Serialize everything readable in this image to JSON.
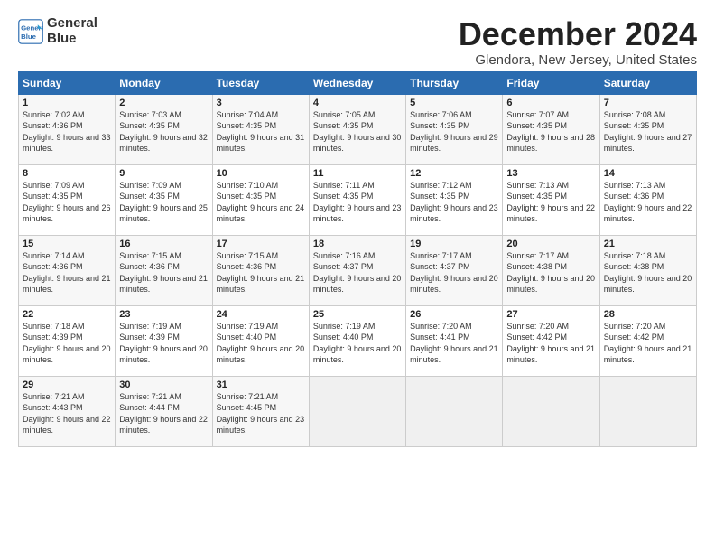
{
  "header": {
    "logo_line1": "General",
    "logo_line2": "Blue",
    "month": "December 2024",
    "location": "Glendora, New Jersey, United States"
  },
  "days_of_week": [
    "Sunday",
    "Monday",
    "Tuesday",
    "Wednesday",
    "Thursday",
    "Friday",
    "Saturday"
  ],
  "weeks": [
    [
      {
        "day": "1",
        "sunrise": "7:02 AM",
        "sunset": "4:36 PM",
        "daylight": "9 hours and 33 minutes."
      },
      {
        "day": "2",
        "sunrise": "7:03 AM",
        "sunset": "4:35 PM",
        "daylight": "9 hours and 32 minutes."
      },
      {
        "day": "3",
        "sunrise": "7:04 AM",
        "sunset": "4:35 PM",
        "daylight": "9 hours and 31 minutes."
      },
      {
        "day": "4",
        "sunrise": "7:05 AM",
        "sunset": "4:35 PM",
        "daylight": "9 hours and 30 minutes."
      },
      {
        "day": "5",
        "sunrise": "7:06 AM",
        "sunset": "4:35 PM",
        "daylight": "9 hours and 29 minutes."
      },
      {
        "day": "6",
        "sunrise": "7:07 AM",
        "sunset": "4:35 PM",
        "daylight": "9 hours and 28 minutes."
      },
      {
        "day": "7",
        "sunrise": "7:08 AM",
        "sunset": "4:35 PM",
        "daylight": "9 hours and 27 minutes."
      }
    ],
    [
      {
        "day": "8",
        "sunrise": "7:09 AM",
        "sunset": "4:35 PM",
        "daylight": "9 hours and 26 minutes."
      },
      {
        "day": "9",
        "sunrise": "7:09 AM",
        "sunset": "4:35 PM",
        "daylight": "9 hours and 25 minutes."
      },
      {
        "day": "10",
        "sunrise": "7:10 AM",
        "sunset": "4:35 PM",
        "daylight": "9 hours and 24 minutes."
      },
      {
        "day": "11",
        "sunrise": "7:11 AM",
        "sunset": "4:35 PM",
        "daylight": "9 hours and 23 minutes."
      },
      {
        "day": "12",
        "sunrise": "7:12 AM",
        "sunset": "4:35 PM",
        "daylight": "9 hours and 23 minutes."
      },
      {
        "day": "13",
        "sunrise": "7:13 AM",
        "sunset": "4:35 PM",
        "daylight": "9 hours and 22 minutes."
      },
      {
        "day": "14",
        "sunrise": "7:13 AM",
        "sunset": "4:36 PM",
        "daylight": "9 hours and 22 minutes."
      }
    ],
    [
      {
        "day": "15",
        "sunrise": "7:14 AM",
        "sunset": "4:36 PM",
        "daylight": "9 hours and 21 minutes."
      },
      {
        "day": "16",
        "sunrise": "7:15 AM",
        "sunset": "4:36 PM",
        "daylight": "9 hours and 21 minutes."
      },
      {
        "day": "17",
        "sunrise": "7:15 AM",
        "sunset": "4:36 PM",
        "daylight": "9 hours and 21 minutes."
      },
      {
        "day": "18",
        "sunrise": "7:16 AM",
        "sunset": "4:37 PM",
        "daylight": "9 hours and 20 minutes."
      },
      {
        "day": "19",
        "sunrise": "7:17 AM",
        "sunset": "4:37 PM",
        "daylight": "9 hours and 20 minutes."
      },
      {
        "day": "20",
        "sunrise": "7:17 AM",
        "sunset": "4:38 PM",
        "daylight": "9 hours and 20 minutes."
      },
      {
        "day": "21",
        "sunrise": "7:18 AM",
        "sunset": "4:38 PM",
        "daylight": "9 hours and 20 minutes."
      }
    ],
    [
      {
        "day": "22",
        "sunrise": "7:18 AM",
        "sunset": "4:39 PM",
        "daylight": "9 hours and 20 minutes."
      },
      {
        "day": "23",
        "sunrise": "7:19 AM",
        "sunset": "4:39 PM",
        "daylight": "9 hours and 20 minutes."
      },
      {
        "day": "24",
        "sunrise": "7:19 AM",
        "sunset": "4:40 PM",
        "daylight": "9 hours and 20 minutes."
      },
      {
        "day": "25",
        "sunrise": "7:19 AM",
        "sunset": "4:40 PM",
        "daylight": "9 hours and 20 minutes."
      },
      {
        "day": "26",
        "sunrise": "7:20 AM",
        "sunset": "4:41 PM",
        "daylight": "9 hours and 21 minutes."
      },
      {
        "day": "27",
        "sunrise": "7:20 AM",
        "sunset": "4:42 PM",
        "daylight": "9 hours and 21 minutes."
      },
      {
        "day": "28",
        "sunrise": "7:20 AM",
        "sunset": "4:42 PM",
        "daylight": "9 hours and 21 minutes."
      }
    ],
    [
      {
        "day": "29",
        "sunrise": "7:21 AM",
        "sunset": "4:43 PM",
        "daylight": "9 hours and 22 minutes."
      },
      {
        "day": "30",
        "sunrise": "7:21 AM",
        "sunset": "4:44 PM",
        "daylight": "9 hours and 22 minutes."
      },
      {
        "day": "31",
        "sunrise": "7:21 AM",
        "sunset": "4:45 PM",
        "daylight": "9 hours and 23 minutes."
      },
      null,
      null,
      null,
      null
    ]
  ]
}
